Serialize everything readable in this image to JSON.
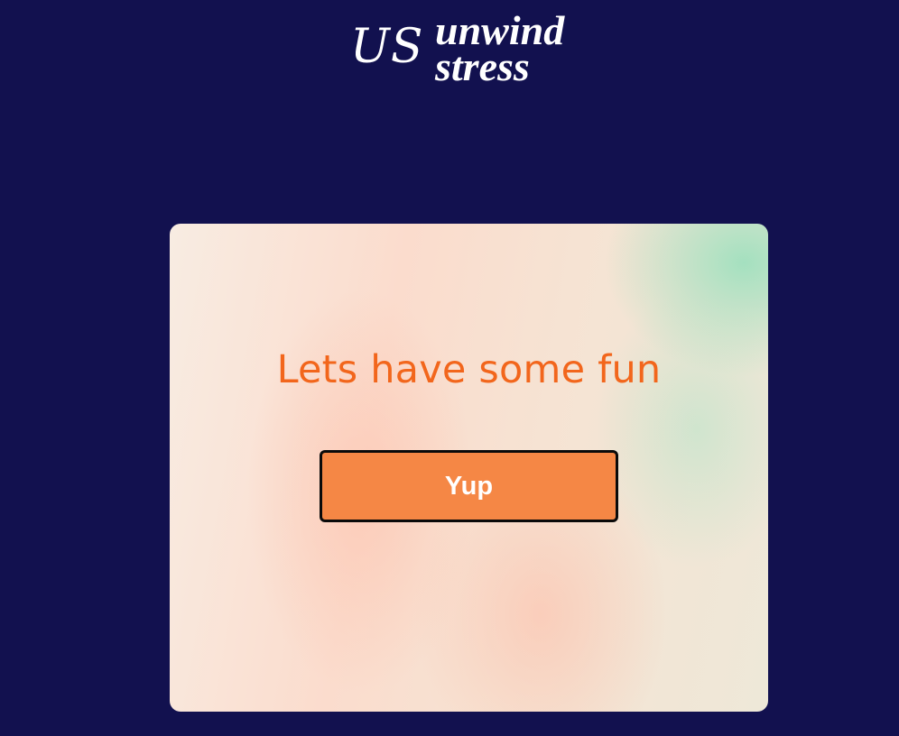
{
  "header": {
    "logo_mark": "US",
    "logo_line1": "unwind",
    "logo_line2": "stress"
  },
  "card": {
    "title": "Lets have some fun",
    "button_label": "Yup"
  },
  "colors": {
    "page_background": "#12114f",
    "title_color": "#f2661c",
    "button_background": "#f58745",
    "button_border": "#0a0a0a",
    "button_text": "#ffffff"
  }
}
